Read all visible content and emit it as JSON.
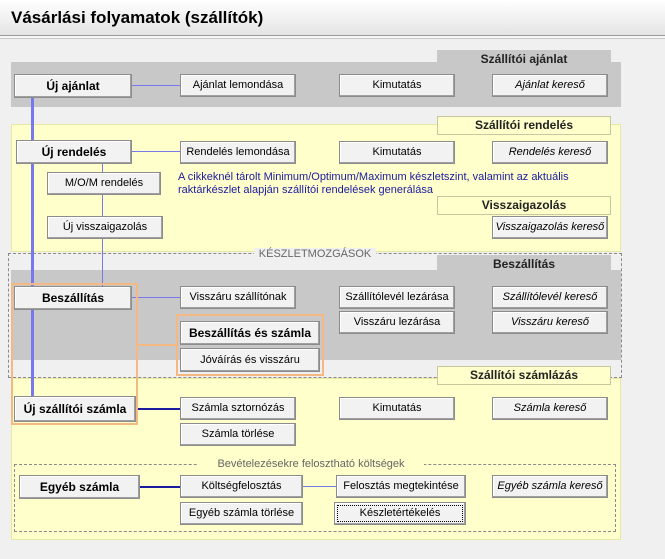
{
  "window": {
    "title": "Vásárlási folyamatok (szállítók)"
  },
  "sections": {
    "ajanlat": "Szállítói ajánlat",
    "rendeles": "Szállítói rendelés",
    "visszaigazolas": "Visszaigazolás",
    "keszletmozgasok": "KÉSZLETMOZGÁSOK",
    "beszallitas": "Beszállítás",
    "szamlazas": "Szállítói számlázás",
    "koltsegek": "Bevételezésekre felosztható költségek"
  },
  "buttons": {
    "uj_ajanlat": "Új ajánlat",
    "ajanlat_lemondasa": "Ajánlat lemondása",
    "kimutatas_ajanlat": "Kimutatás",
    "ajanlat_kereso": "Ajánlat kereső",
    "uj_rendeles": "Új rendelés",
    "rendeles_lemondasa": "Rendelés lemondása",
    "kimutatas_rendeles": "Kimutatás",
    "rendeles_kereso": "Rendelés kereső",
    "mom_rendeles": "M/O/M rendelés",
    "uj_visszaigazolas": "Új visszaigazolás",
    "visszaigazolas_kereso": "Visszaigazolás kereső",
    "beszallitas": "Beszállítás",
    "visszaru_szallitonak": "Visszáru szállítónak",
    "szallitolevel_lezarasa": "Szállítólevél lezárása",
    "szallitolevel_kereso": "Szállítólevél kereső",
    "visszaru_lezarasa": "Visszáru lezárása",
    "visszaru_kereso": "Visszáru kereső",
    "beszallitas_es_szamla": "Beszállítás és számla",
    "jovairas_es_visszaru": "Jóváírás és visszáru",
    "uj_szallitoi_szamla": "Új szállítói számla",
    "szamla_sztornozas": "Számla sztornózás",
    "kimutatas_szamla": "Kimutatás",
    "szamla_kereso": "Számla kereső",
    "szamla_torlese": "Számla törlése",
    "egyeb_szamla": "Egyéb számla",
    "koltsegfelosztas": "Költségfelosztás",
    "felosztas_megtekintese": "Felosztás megtekintése",
    "egyeb_szamla_kereso": "Egyéb számla kereső",
    "egyeb_szamla_torlese": "Egyéb számla törlése",
    "keszletertekeles": "Készletértékelés"
  },
  "notes": {
    "mom": "A cikkeknél tárolt Minimum/Optimum/Maximum készletszint, valamint az aktuális raktárkészlet alapján szállítói rendelések generálása"
  }
}
